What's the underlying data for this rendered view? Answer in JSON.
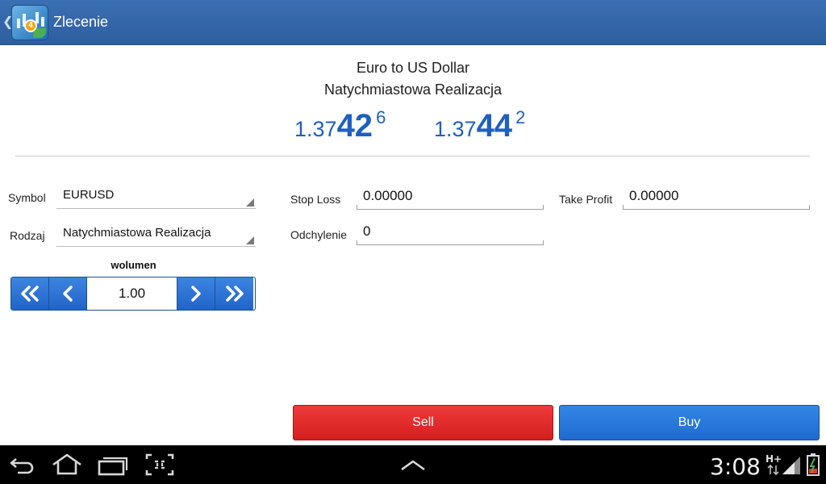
{
  "header": {
    "title": "Zlecenie",
    "back_glyph": "❮",
    "badge_text": "4"
  },
  "instrument": {
    "name": "Euro to US Dollar",
    "execution": "Natychmiastowa Realizacja"
  },
  "prices": {
    "bid": {
      "prefix": "1.37",
      "big": "42",
      "sup": "6"
    },
    "ask": {
      "prefix": "1.37",
      "big": "44",
      "sup": "2"
    },
    "color": "#1f5fbf"
  },
  "form": {
    "symbol_label": "Symbol",
    "symbol_value": "EURUSD",
    "type_label": "Rodzaj",
    "type_value": "Natychmiastowa Realizacja",
    "stop_loss_label": "Stop Loss",
    "stop_loss_value": "0.00000",
    "take_profit_label": "Take Profit",
    "take_profit_value": "0.00000",
    "deviation_label": "Odchylenie",
    "deviation_value": "0"
  },
  "volume": {
    "label": "wolumen",
    "value": "1.00",
    "icons": [
      "double-chevron-left-icon",
      "chevron-left-icon",
      "chevron-right-icon",
      "double-chevron-right-icon"
    ]
  },
  "actions": {
    "sell_label": "Sell",
    "buy_label": "Buy",
    "sell_color": "#e02a2a",
    "buy_color": "#2775da"
  },
  "system_bar": {
    "time": "3:08",
    "network": "H+",
    "icons": [
      "back-icon",
      "home-icon",
      "recent-apps-icon",
      "screenshot-icon",
      "up-chevron-icon",
      "signal-icon",
      "battery-icon"
    ]
  }
}
